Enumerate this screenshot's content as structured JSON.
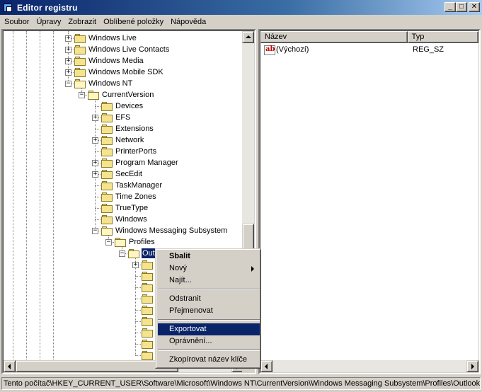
{
  "window": {
    "title": "Editor registru"
  },
  "menubar": [
    "Soubor",
    "Úpravy",
    "Zobrazit",
    "Oblíbené položky",
    "Nápověda"
  ],
  "tree": {
    "nodes": [
      {
        "label": "Windows Live",
        "level": 0,
        "expander": "+"
      },
      {
        "label": "Windows Live Contacts",
        "level": 0,
        "expander": "+"
      },
      {
        "label": "Windows Media",
        "level": 0,
        "expander": "+"
      },
      {
        "label": "Windows Mobile SDK",
        "level": 0,
        "expander": "+"
      },
      {
        "label": "Windows NT",
        "level": 0,
        "expander": "-"
      },
      {
        "label": "CurrentVersion",
        "level": 1,
        "expander": "-"
      },
      {
        "label": "Devices",
        "level": 2,
        "expander": ""
      },
      {
        "label": "EFS",
        "level": 2,
        "expander": "+"
      },
      {
        "label": "Extensions",
        "level": 2,
        "expander": ""
      },
      {
        "label": "Network",
        "level": 2,
        "expander": "+"
      },
      {
        "label": "PrinterPorts",
        "level": 2,
        "expander": ""
      },
      {
        "label": "Program Manager",
        "level": 2,
        "expander": "+"
      },
      {
        "label": "SecEdit",
        "level": 2,
        "expander": "+"
      },
      {
        "label": "TaskManager",
        "level": 2,
        "expander": ""
      },
      {
        "label": "Time Zones",
        "level": 2,
        "expander": ""
      },
      {
        "label": "TrueType",
        "level": 2,
        "expander": ""
      },
      {
        "label": "Windows",
        "level": 2,
        "expander": ""
      },
      {
        "label": "Windows Messaging Subsystem",
        "level": 2,
        "expander": "-"
      },
      {
        "label": "Profiles",
        "level": 3,
        "expander": "-"
      },
      {
        "label": "Outlook",
        "level": 4,
        "expander": "-",
        "selected": true,
        "visible_text": "Outl"
      },
      {
        "label": "",
        "level": 5,
        "expander": "+"
      },
      {
        "label": "",
        "level": 5,
        "expander": ""
      },
      {
        "label": "",
        "level": 5,
        "expander": ""
      },
      {
        "label": "",
        "level": 5,
        "expander": ""
      },
      {
        "label": "",
        "level": 5,
        "expander": ""
      },
      {
        "label": "",
        "level": 5,
        "expander": ""
      },
      {
        "label": "",
        "level": 5,
        "expander": ""
      },
      {
        "label": "",
        "level": 5,
        "expander": ""
      },
      {
        "label": "",
        "level": 5,
        "expander": ""
      }
    ]
  },
  "list": {
    "columns": [
      "Název",
      "Typ"
    ],
    "rows": [
      {
        "name": "(Výchozí)",
        "type": "REG_SZ",
        "icon": "string-value-icon"
      }
    ]
  },
  "context_menu": {
    "items": [
      {
        "label": "Sbalit",
        "bold": true
      },
      {
        "label": "Nový",
        "submenu": true
      },
      {
        "label": "Najít..."
      },
      {
        "separator": true
      },
      {
        "label": "Odstranit"
      },
      {
        "label": "Přejmenovat"
      },
      {
        "separator": true
      },
      {
        "label": "Exportovat",
        "highlighted": true
      },
      {
        "label": "Oprávnění..."
      },
      {
        "separator": true
      },
      {
        "label": "Zkopírovat název klíče"
      }
    ]
  },
  "statusbar": {
    "path": "Tento počítač\\HKEY_CURRENT_USER\\Software\\Microsoft\\Windows NT\\CurrentVersion\\Windows Messaging Subsystem\\Profiles\\Outlook"
  },
  "colors": {
    "selection": "#0a246a",
    "face": "#d4d0c8",
    "title_start": "#0a246a",
    "title_end": "#a6caf0"
  }
}
